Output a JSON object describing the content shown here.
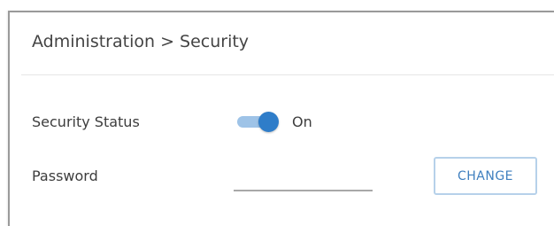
{
  "header": {
    "breadcrumb": "Administration > Security"
  },
  "settings": {
    "security_status": {
      "label": "Security Status",
      "toggle_state": "On",
      "enabled": true
    },
    "password": {
      "label": "Password",
      "value": "",
      "button_label": "CHANGE"
    }
  },
  "colors": {
    "accent": "#2f7dc9",
    "toggle_track": "#9ec3e7",
    "button_border": "#b6d1ea",
    "button_text": "#3f7fbf"
  }
}
